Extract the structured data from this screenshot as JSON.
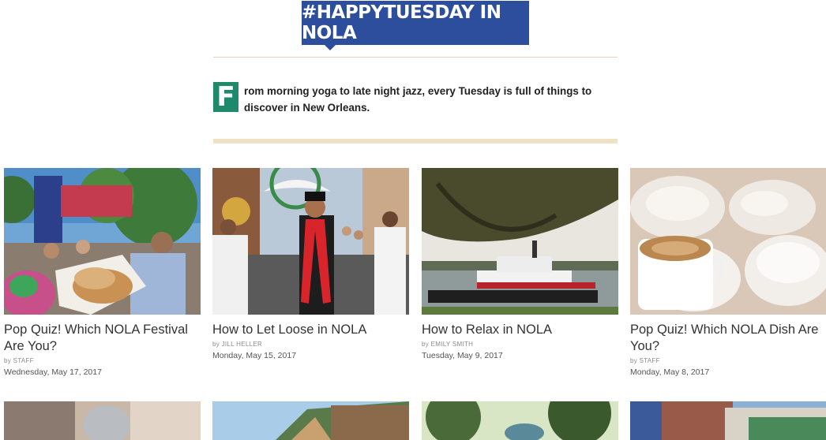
{
  "header": {
    "banner": "#HAPPYTUESDAY IN NOLA",
    "dropcap": "F",
    "intro": "rom morning yoga to late night jazz, every Tuesday is full of things to discover in New Orleans."
  },
  "cards": [
    {
      "title": "Pop Quiz! Which NOLA Festival Are You?",
      "byline": "by STAFF",
      "date": "Wednesday, May 17, 2017"
    },
    {
      "title": "How to Let Loose in NOLA",
      "byline": "by JILL HELLER",
      "date": "Monday, May 15, 2017"
    },
    {
      "title": "How to Relax in NOLA",
      "byline": "by EMILY SMITH",
      "date": "Tuesday, May 9, 2017"
    },
    {
      "title": "Pop Quiz! Which NOLA Dish Are You?",
      "byline": "by STAFF",
      "date": "Monday, May 8, 2017"
    }
  ],
  "colors": {
    "banner_blue": "#2d4e9c",
    "dropcap_green": "#1f8a6b",
    "rule_tan": "#efe2c4"
  }
}
